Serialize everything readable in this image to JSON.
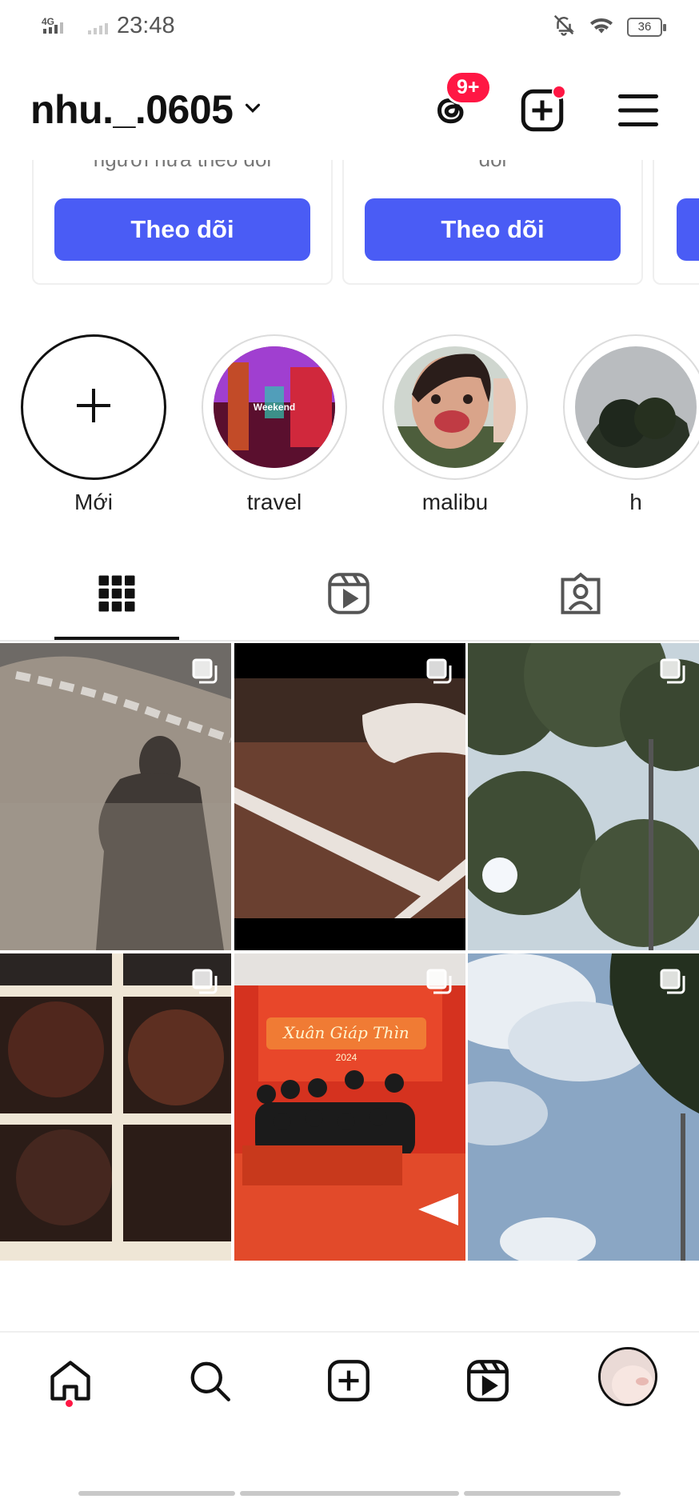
{
  "status_bar": {
    "network_label": "4G",
    "time": "23:48",
    "battery": "36"
  },
  "header": {
    "username": "nhu._.0605",
    "threads_badge": "9+"
  },
  "suggestions": {
    "cards": [
      {
        "subtext": "người nữa theo dõi",
        "button": "Theo dõi"
      },
      {
        "subtext": "dõi",
        "button": "Theo dõi"
      }
    ]
  },
  "highlights": [
    {
      "label": "Mới"
    },
    {
      "label": "travel",
      "overlay": "Weekend"
    },
    {
      "label": "malibu"
    },
    {
      "label": "h"
    }
  ],
  "posts": [
    {
      "theme": "shadow-ground"
    },
    {
      "theme": "track"
    },
    {
      "theme": "tree-sky"
    },
    {
      "theme": "window"
    },
    {
      "theme": "tet-group",
      "caption": "Xuân Giáp Thìn",
      "year": "2024"
    },
    {
      "theme": "clouds"
    }
  ],
  "icons": {
    "chevron": "chevron-down-icon",
    "threads": "threads-icon",
    "create": "create-post-icon",
    "menu": "hamburger-menu-icon"
  },
  "colors": {
    "accent": "#4a5cf5",
    "badge": "#ff1744"
  }
}
